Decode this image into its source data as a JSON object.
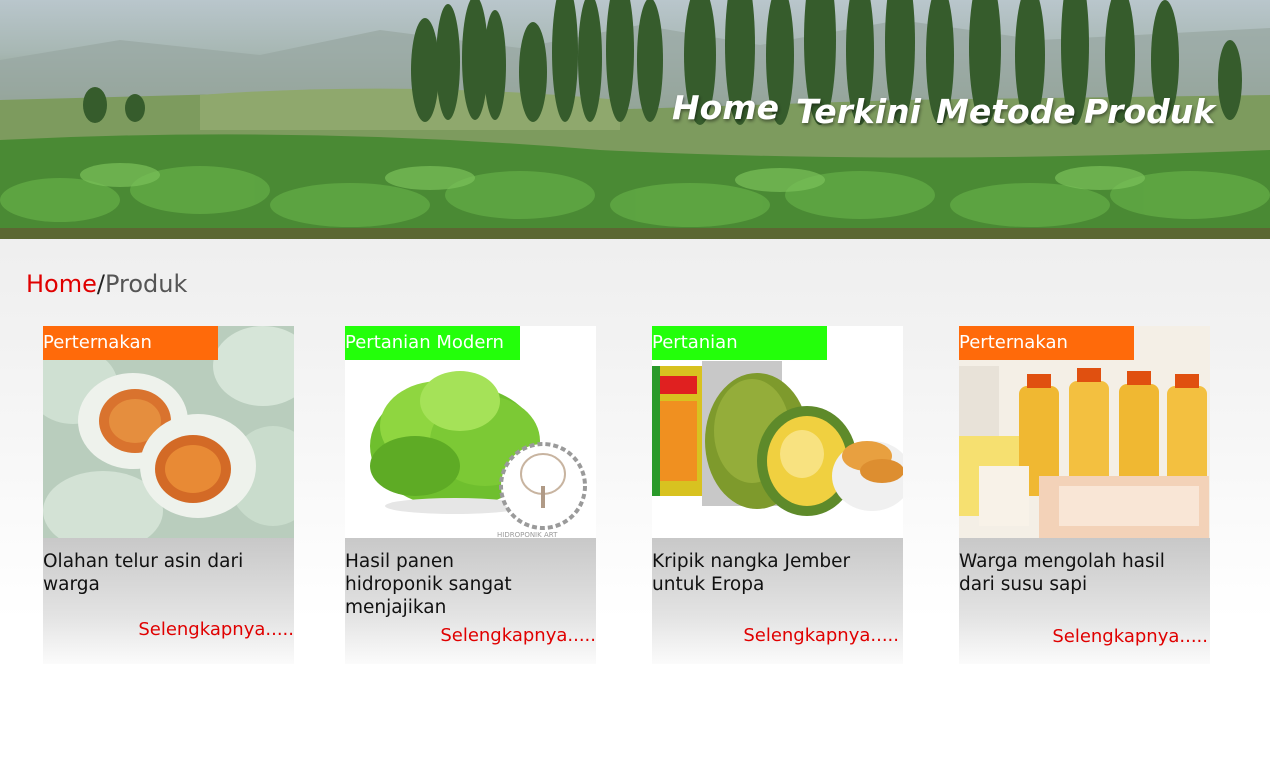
{
  "nav": {
    "items": [
      {
        "label": "Home"
      },
      {
        "label": "Terkini"
      },
      {
        "label": "Metode"
      },
      {
        "label": "Produk"
      }
    ]
  },
  "breadcrumb": {
    "home": "Home",
    "separator": "/",
    "current": "Produk"
  },
  "cards": [
    {
      "tag": "Perternakan",
      "title": "Olahan telur asin dari warga",
      "more": "Selengkapnya.....",
      "tag_color": "#ff6a0a"
    },
    {
      "tag": "Pertanian Modern",
      "title": "Hasil panen hidroponik sangat menjajikan",
      "more": "Selengkapnya.....",
      "tag_color": "#23ff0a"
    },
    {
      "tag": "Pertanian",
      "title": "Kripik nangka Jember untuk Eropa",
      "more": "Selengkapnya.....",
      "tag_color": "#23ff0a"
    },
    {
      "tag": "Perternakan",
      "title": "Warga mengolah hasil dari susu sapi",
      "more": "Selengkapnya.....",
      "tag_color": "#ff6a0a"
    }
  ],
  "colors": {
    "link_red": "#e00000",
    "tag_orange": "#ff6a0a",
    "tag_green": "#23ff0a"
  }
}
